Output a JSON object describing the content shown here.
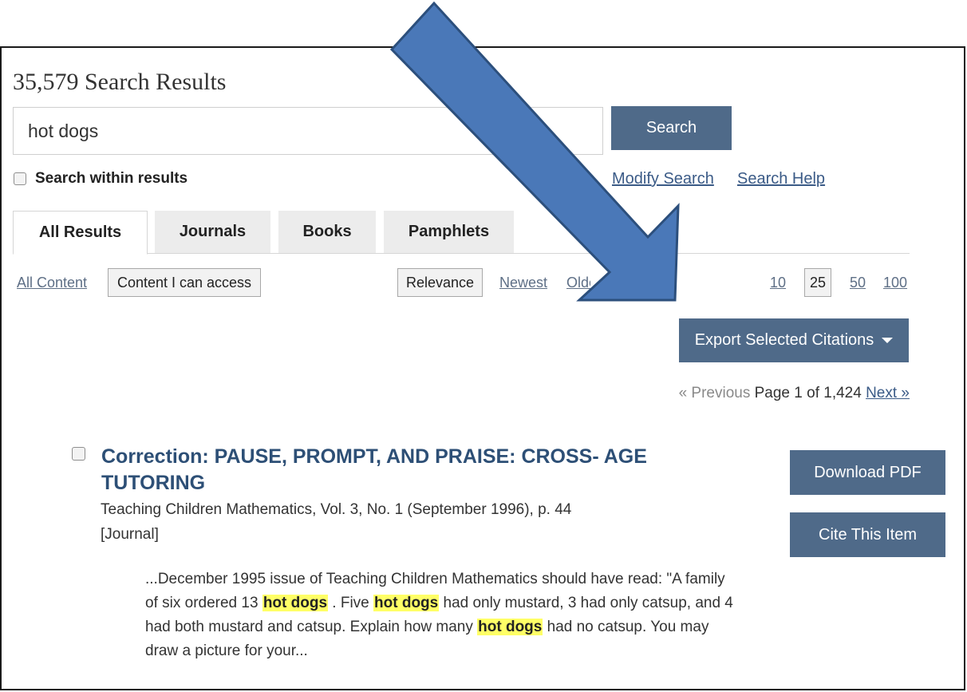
{
  "results_count_title": "35,579 Search Results",
  "search": {
    "value": "hot dogs",
    "button_label": "Search"
  },
  "within_results_label": "Search within results",
  "links": {
    "modify_search": "Modify Search",
    "search_help": "Search Help"
  },
  "tabs": [
    {
      "label": "All Results",
      "active": true
    },
    {
      "label": "Journals",
      "active": false
    },
    {
      "label": "Books",
      "active": false
    },
    {
      "label": "Pamphlets",
      "active": false
    }
  ],
  "filters": {
    "all_content": "All Content",
    "content_access": "Content I can access"
  },
  "sort": {
    "relevance": "Relevance",
    "newest": "Newest",
    "oldest": "Oldest"
  },
  "per_page": {
    "p10": "10",
    "p25": "25",
    "p50": "50",
    "p100": "100"
  },
  "export_label": "Export Selected Citations",
  "pagination": {
    "previous": "« Previous",
    "page_text": "Page 1 of 1,424",
    "next": "Next »"
  },
  "result": {
    "title": "Correction: PAUSE, PROMPT, AND PRAISE: CROSS- AGE TUTORING",
    "meta": "Teaching Children Mathematics, Vol. 3, No. 1 (September 1996), p. 44",
    "type": "[Journal]",
    "snippet_1": "...December 1995 issue of Teaching Children Mathematics should have read: \"A family of six ordered 13 ",
    "highlight": "hot dogs",
    "snippet_2": " . Five ",
    "snippet_3": " had only mustard, 3 had only catsup, and 4 had both mustard and catsup. Explain how many ",
    "snippet_4": " had no catsup. You may draw a picture for your...",
    "download_label": "Download PDF",
    "cite_label": "Cite This Item"
  },
  "colors": {
    "button_bg": "#4f6a89",
    "arrow_fill": "#4a78b8",
    "link": "#3b5b87",
    "highlight": "#ffff66"
  },
  "annotation_icon": "arrow-annotation"
}
